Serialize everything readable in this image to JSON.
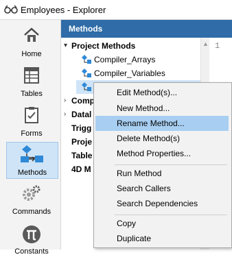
{
  "window": {
    "title": "Employees - Explorer"
  },
  "sidebar": {
    "items": [
      {
        "label": "Home",
        "icon": "home-icon"
      },
      {
        "label": "Tables",
        "icon": "tables-icon"
      },
      {
        "label": "Forms",
        "icon": "forms-icon"
      },
      {
        "label": "Methods",
        "icon": "methods-icon",
        "active": true
      },
      {
        "label": "Commands",
        "icon": "commands-icon"
      },
      {
        "label": "Constants",
        "icon": "pi-icon"
      }
    ]
  },
  "panel": {
    "header": "Methods"
  },
  "tree": {
    "project_methods": "Project Methods",
    "methods": [
      "Compiler_Arrays",
      "Compiler_Variables"
    ],
    "groups": [
      "Comp",
      "Datal",
      "Trigg",
      "Proje",
      "Table",
      "4D M"
    ]
  },
  "editor": {
    "line_number": "1"
  },
  "context_menu": {
    "items": [
      {
        "label": "Edit Method(s)..."
      },
      {
        "label": "New Method..."
      },
      {
        "label": "Rename Method...",
        "highlighted": true
      },
      {
        "label": "Delete Method(s)"
      },
      {
        "label": "Method Properties..."
      },
      {
        "label": "Run Method"
      },
      {
        "label": "Search Callers"
      },
      {
        "label": "Search Dependencies"
      },
      {
        "label": "Copy"
      },
      {
        "label": "Duplicate"
      }
    ]
  },
  "colors": {
    "header_bg": "#2f6ca8",
    "highlight": "#a8cff2",
    "active_nav": "#cfe4f7"
  }
}
